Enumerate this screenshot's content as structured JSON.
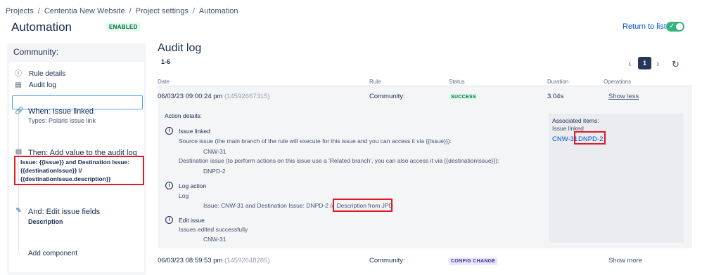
{
  "breadcrumb": [
    "Projects",
    "Cententia New Website",
    "Project settings",
    "Automation"
  ],
  "header": {
    "title": "Automation",
    "enabled_badge": "ENABLED",
    "return_label": "Return to list",
    "toggle_on": true
  },
  "sidebar": {
    "header": "Community:",
    "nav": [
      {
        "icon": "info-icon",
        "label": "Rule details"
      },
      {
        "icon": "document-icon",
        "label": "Audit log",
        "selected": true
      }
    ],
    "steps": [
      {
        "icon": "link-icon",
        "title": "When: Issue linked",
        "subtitle": "Types: Polaris issue link"
      },
      {
        "icon": "document-icon",
        "title": "Then: Add value to the audit log",
        "lines": [
          "Issue: {{issue}} and Destination Issue:",
          "{{destinationIssue}} //",
          "{{destinationIssue.description}}"
        ]
      },
      {
        "icon": "pencil-icon",
        "title": "And: Edit issue fields",
        "subtitle": "Description"
      }
    ],
    "add_component": "Add component"
  },
  "audit": {
    "title": "Audit log",
    "count": "1-6",
    "page": "1",
    "columns": {
      "date": "Date",
      "rule": "Rule",
      "status": "Status",
      "duration": "Duration",
      "operations": "Operations"
    },
    "rows": [
      {
        "date": "06/03/23 09:00:24 pm",
        "id": "(14592667315)",
        "rule": "Community:",
        "status": "SUCCESS",
        "duration": "3.04s",
        "op": "Show less"
      },
      {
        "date": "06/03/23 08:59:53 pm",
        "id": "(14592648285)",
        "rule": "Community:",
        "status": "CONFIG CHANGE",
        "duration": "",
        "op": "Show more"
      }
    ],
    "details": {
      "heading": "Action details:",
      "issue_linked": {
        "title": "Issue linked",
        "source_text": "Source issue (the main branch of the rule will execute for this issue and you can access it via {{issue}}):",
        "source_value": "CNW-31",
        "dest_text": "Destination issue (to perform actions on this issue use a 'Related branch', you can also access it via {{destinationIssue}}):",
        "dest_value": "DNPD-2"
      },
      "log_action": {
        "title": "Log action",
        "sub": "Log",
        "message_prefix": "Issue: CNW-31 and Destination Issue: DNPD-2 //",
        "message_highlight": "Description from JPD"
      },
      "edit_issue": {
        "title": "Edit issue",
        "sub": "Issues edited successfully",
        "value": "CNW-31"
      },
      "associated": {
        "title": "Associated items:",
        "sub": "Issue linked",
        "item1": "CNW-31",
        "item2": "DNPD-2"
      }
    }
  },
  "colors": {
    "accent": "#0052cc",
    "success": "#36b37e",
    "highlight": "#e01b24"
  }
}
